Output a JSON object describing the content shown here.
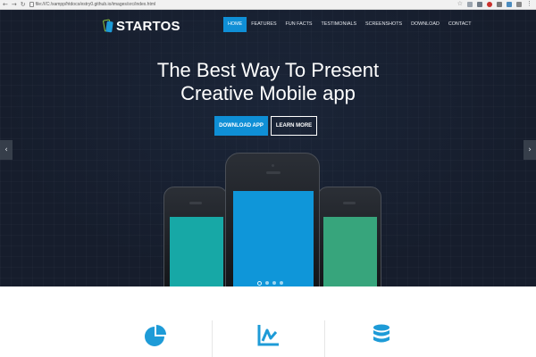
{
  "browser": {
    "url": "file:///C:/xampp/htdocs/estry0.github.io/images/src/index.html",
    "nav_icons": [
      "back-icon",
      "forward-icon",
      "reload-icon",
      "home-icon"
    ],
    "extension_icons": [
      "star-icon",
      "extension-icon",
      "extension-icon",
      "adblock-icon",
      "extension-icon",
      "extension-icon",
      "extension-icon",
      "menu-icon"
    ]
  },
  "brand": {
    "name": "STARTOS",
    "logo_colors": {
      "outline": "#8cc63f",
      "fill": "#1e9bd7"
    }
  },
  "nav": {
    "items": [
      {
        "label": "HOME",
        "active": true
      },
      {
        "label": "FEATURES",
        "active": false
      },
      {
        "label": "FUN FACTS",
        "active": false
      },
      {
        "label": "TESTIMONIALS",
        "active": false
      },
      {
        "label": "SCREENSHOTS",
        "active": false
      },
      {
        "label": "DOWNLOAD",
        "active": false
      },
      {
        "label": "CONTACT",
        "active": false
      }
    ]
  },
  "hero": {
    "headline_line1": "The Best Way To Present",
    "headline_line2": "Creative Mobile app",
    "primary_button": "DOWNLOAD APP",
    "secondary_button": "LEARN MORE",
    "carousel": {
      "prev_icon": "chevron-left-icon",
      "next_icon": "chevron-right-icon",
      "slides": 4,
      "active_slide": 1
    },
    "phone_screen_colors": {
      "left": "#17a8a6",
      "center": "#0f96d9",
      "right": "#37a57c"
    }
  },
  "features": {
    "icons": [
      "pie-chart-icon",
      "line-chart-icon",
      "database-icon"
    ]
  },
  "colors": {
    "accent": "#0f8fd6",
    "hero_background": "#161d2c"
  }
}
